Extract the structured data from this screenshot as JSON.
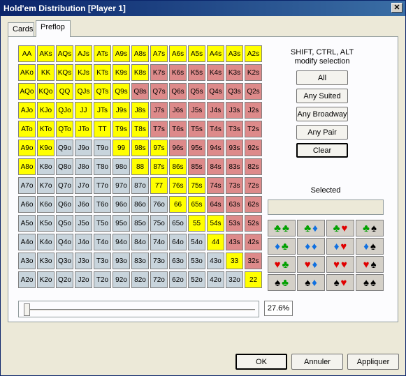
{
  "window": {
    "title": "Hold'em Distribution [Player 1]",
    "close_glyph": "✕"
  },
  "tabs": [
    {
      "label": "Cards"
    },
    {
      "label": "Preflop"
    }
  ],
  "hint": {
    "line1": "SHIFT, CTRL, ALT",
    "line2": "modify selection"
  },
  "buttons": {
    "all": "All",
    "any_suited": "Any Suited",
    "any_broadway": "Any Broadway",
    "any_pair": "Any Pair",
    "clear": "Clear"
  },
  "selected_label": "Selected",
  "slider": {
    "value_percent": 27.6,
    "display": "27.6%"
  },
  "footer": {
    "ok": "OK",
    "cancel": "Annuler",
    "apply": "Appliquer"
  },
  "colors": {
    "selected": "#ffff00",
    "suited": "#dd8a8a",
    "offsuit": "#c8d4dc"
  },
  "hand_grid": [
    [
      {
        "l": "AA",
        "s": 1
      },
      {
        "l": "AKs",
        "s": 1
      },
      {
        "l": "AQs",
        "s": 1
      },
      {
        "l": "AJs",
        "s": 1
      },
      {
        "l": "ATs",
        "s": 1
      },
      {
        "l": "A9s",
        "s": 1
      },
      {
        "l": "A8s",
        "s": 1
      },
      {
        "l": "A7s",
        "s": 1
      },
      {
        "l": "A6s",
        "s": 1
      },
      {
        "l": "A5s",
        "s": 1
      },
      {
        "l": "A4s",
        "s": 1
      },
      {
        "l": "A3s",
        "s": 1
      },
      {
        "l": "A2s",
        "s": 1
      }
    ],
    [
      {
        "l": "AKo",
        "s": 1
      },
      {
        "l": "KK",
        "s": 1
      },
      {
        "l": "KQs",
        "s": 1
      },
      {
        "l": "KJs",
        "s": 1
      },
      {
        "l": "KTs",
        "s": 1
      },
      {
        "l": "K9s",
        "s": 1
      },
      {
        "l": "K8s",
        "s": 1
      },
      {
        "l": "K7s",
        "s": 0
      },
      {
        "l": "K6s",
        "s": 0
      },
      {
        "l": "K5s",
        "s": 0
      },
      {
        "l": "K4s",
        "s": 0
      },
      {
        "l": "K3s",
        "s": 0
      },
      {
        "l": "K2s",
        "s": 0
      }
    ],
    [
      {
        "l": "AQo",
        "s": 1
      },
      {
        "l": "KQo",
        "s": 1
      },
      {
        "l": "QQ",
        "s": 1
      },
      {
        "l": "QJs",
        "s": 1
      },
      {
        "l": "QTs",
        "s": 1
      },
      {
        "l": "Q9s",
        "s": 1
      },
      {
        "l": "Q8s",
        "s": 0
      },
      {
        "l": "Q7s",
        "s": 0
      },
      {
        "l": "Q6s",
        "s": 0
      },
      {
        "l": "Q5s",
        "s": 0
      },
      {
        "l": "Q4s",
        "s": 0
      },
      {
        "l": "Q3s",
        "s": 0
      },
      {
        "l": "Q2s",
        "s": 0
      }
    ],
    [
      {
        "l": "AJo",
        "s": 1
      },
      {
        "l": "KJo",
        "s": 1
      },
      {
        "l": "QJo",
        "s": 1
      },
      {
        "l": "JJ",
        "s": 1
      },
      {
        "l": "JTs",
        "s": 1
      },
      {
        "l": "J9s",
        "s": 1
      },
      {
        "l": "J8s",
        "s": 1
      },
      {
        "l": "J7s",
        "s": 0
      },
      {
        "l": "J6s",
        "s": 0
      },
      {
        "l": "J5s",
        "s": 0
      },
      {
        "l": "J4s",
        "s": 0
      },
      {
        "l": "J3s",
        "s": 0
      },
      {
        "l": "J2s",
        "s": 0
      }
    ],
    [
      {
        "l": "ATo",
        "s": 1
      },
      {
        "l": "KTo",
        "s": 1
      },
      {
        "l": "QTo",
        "s": 1
      },
      {
        "l": "JTo",
        "s": 1
      },
      {
        "l": "TT",
        "s": 1
      },
      {
        "l": "T9s",
        "s": 1
      },
      {
        "l": "T8s",
        "s": 1
      },
      {
        "l": "T7s",
        "s": 0
      },
      {
        "l": "T6s",
        "s": 0
      },
      {
        "l": "T5s",
        "s": 0
      },
      {
        "l": "T4s",
        "s": 0
      },
      {
        "l": "T3s",
        "s": 0
      },
      {
        "l": "T2s",
        "s": 0
      }
    ],
    [
      {
        "l": "A9o",
        "s": 1
      },
      {
        "l": "K9o",
        "s": 1
      },
      {
        "l": "Q9o",
        "s": 0
      },
      {
        "l": "J9o",
        "s": 0
      },
      {
        "l": "T9o",
        "s": 0
      },
      {
        "l": "99",
        "s": 1
      },
      {
        "l": "98s",
        "s": 1
      },
      {
        "l": "97s",
        "s": 1
      },
      {
        "l": "96s",
        "s": 0
      },
      {
        "l": "95s",
        "s": 0
      },
      {
        "l": "94s",
        "s": 0
      },
      {
        "l": "93s",
        "s": 0
      },
      {
        "l": "92s",
        "s": 0
      }
    ],
    [
      {
        "l": "A8o",
        "s": 1
      },
      {
        "l": "K8o",
        "s": 0
      },
      {
        "l": "Q8o",
        "s": 0
      },
      {
        "l": "J8o",
        "s": 0
      },
      {
        "l": "T8o",
        "s": 0
      },
      {
        "l": "98o",
        "s": 0
      },
      {
        "l": "88",
        "s": 1
      },
      {
        "l": "87s",
        "s": 1
      },
      {
        "l": "86s",
        "s": 1
      },
      {
        "l": "85s",
        "s": 0
      },
      {
        "l": "84s",
        "s": 0
      },
      {
        "l": "83s",
        "s": 0
      },
      {
        "l": "82s",
        "s": 0
      }
    ],
    [
      {
        "l": "A7o",
        "s": 0
      },
      {
        "l": "K7o",
        "s": 0
      },
      {
        "l": "Q7o",
        "s": 0
      },
      {
        "l": "J7o",
        "s": 0
      },
      {
        "l": "T7o",
        "s": 0
      },
      {
        "l": "97o",
        "s": 0
      },
      {
        "l": "87o",
        "s": 0
      },
      {
        "l": "77",
        "s": 1
      },
      {
        "l": "76s",
        "s": 1
      },
      {
        "l": "75s",
        "s": 1
      },
      {
        "l": "74s",
        "s": 0
      },
      {
        "l": "73s",
        "s": 0
      },
      {
        "l": "72s",
        "s": 0
      }
    ],
    [
      {
        "l": "A6o",
        "s": 0
      },
      {
        "l": "K6o",
        "s": 0
      },
      {
        "l": "Q6o",
        "s": 0
      },
      {
        "l": "J6o",
        "s": 0
      },
      {
        "l": "T6o",
        "s": 0
      },
      {
        "l": "96o",
        "s": 0
      },
      {
        "l": "86o",
        "s": 0
      },
      {
        "l": "76o",
        "s": 0
      },
      {
        "l": "66",
        "s": 1
      },
      {
        "l": "65s",
        "s": 1
      },
      {
        "l": "64s",
        "s": 0
      },
      {
        "l": "63s",
        "s": 0
      },
      {
        "l": "62s",
        "s": 0
      }
    ],
    [
      {
        "l": "A5o",
        "s": 0
      },
      {
        "l": "K5o",
        "s": 0
      },
      {
        "l": "Q5o",
        "s": 0
      },
      {
        "l": "J5o",
        "s": 0
      },
      {
        "l": "T5o",
        "s": 0
      },
      {
        "l": "95o",
        "s": 0
      },
      {
        "l": "85o",
        "s": 0
      },
      {
        "l": "75o",
        "s": 0
      },
      {
        "l": "65o",
        "s": 0
      },
      {
        "l": "55",
        "s": 1
      },
      {
        "l": "54s",
        "s": 1
      },
      {
        "l": "53s",
        "s": 0
      },
      {
        "l": "52s",
        "s": 0
      }
    ],
    [
      {
        "l": "A4o",
        "s": 0
      },
      {
        "l": "K4o",
        "s": 0
      },
      {
        "l": "Q4o",
        "s": 0
      },
      {
        "l": "J4o",
        "s": 0
      },
      {
        "l": "T4o",
        "s": 0
      },
      {
        "l": "94o",
        "s": 0
      },
      {
        "l": "84o",
        "s": 0
      },
      {
        "l": "74o",
        "s": 0
      },
      {
        "l": "64o",
        "s": 0
      },
      {
        "l": "54o",
        "s": 0
      },
      {
        "l": "44",
        "s": 1
      },
      {
        "l": "43s",
        "s": 0
      },
      {
        "l": "42s",
        "s": 0
      }
    ],
    [
      {
        "l": "A3o",
        "s": 0
      },
      {
        "l": "K3o",
        "s": 0
      },
      {
        "l": "Q3o",
        "s": 0
      },
      {
        "l": "J3o",
        "s": 0
      },
      {
        "l": "T3o",
        "s": 0
      },
      {
        "l": "93o",
        "s": 0
      },
      {
        "l": "83o",
        "s": 0
      },
      {
        "l": "73o",
        "s": 0
      },
      {
        "l": "63o",
        "s": 0
      },
      {
        "l": "53o",
        "s": 0
      },
      {
        "l": "43o",
        "s": 0
      },
      {
        "l": "33",
        "s": 1
      },
      {
        "l": "32s",
        "s": 0
      }
    ],
    [
      {
        "l": "A2o",
        "s": 0
      },
      {
        "l": "K2o",
        "s": 0
      },
      {
        "l": "Q2o",
        "s": 0
      },
      {
        "l": "J2o",
        "s": 0
      },
      {
        "l": "T2o",
        "s": 0
      },
      {
        "l": "92o",
        "s": 0
      },
      {
        "l": "82o",
        "s": 0
      },
      {
        "l": "72o",
        "s": 0
      },
      {
        "l": "62o",
        "s": 0
      },
      {
        "l": "52o",
        "s": 0
      },
      {
        "l": "42o",
        "s": 0
      },
      {
        "l": "32o",
        "s": 0
      },
      {
        "l": "22",
        "s": 1
      }
    ]
  ],
  "suit_grid": [
    [
      [
        "club",
        "club"
      ],
      [
        "club",
        "diamond"
      ],
      [
        "club",
        "heart"
      ],
      [
        "club",
        "spade"
      ]
    ],
    [
      [
        "diamond",
        "club"
      ],
      [
        "diamond",
        "diamond"
      ],
      [
        "diamond",
        "heart"
      ],
      [
        "diamond",
        "spade"
      ]
    ],
    [
      [
        "heart",
        "club"
      ],
      [
        "heart",
        "diamond"
      ],
      [
        "heart",
        "heart"
      ],
      [
        "heart",
        "spade"
      ]
    ],
    [
      [
        "spade",
        "club"
      ],
      [
        "spade",
        "diamond"
      ],
      [
        "spade",
        "heart"
      ],
      [
        "spade",
        "spade"
      ]
    ]
  ]
}
